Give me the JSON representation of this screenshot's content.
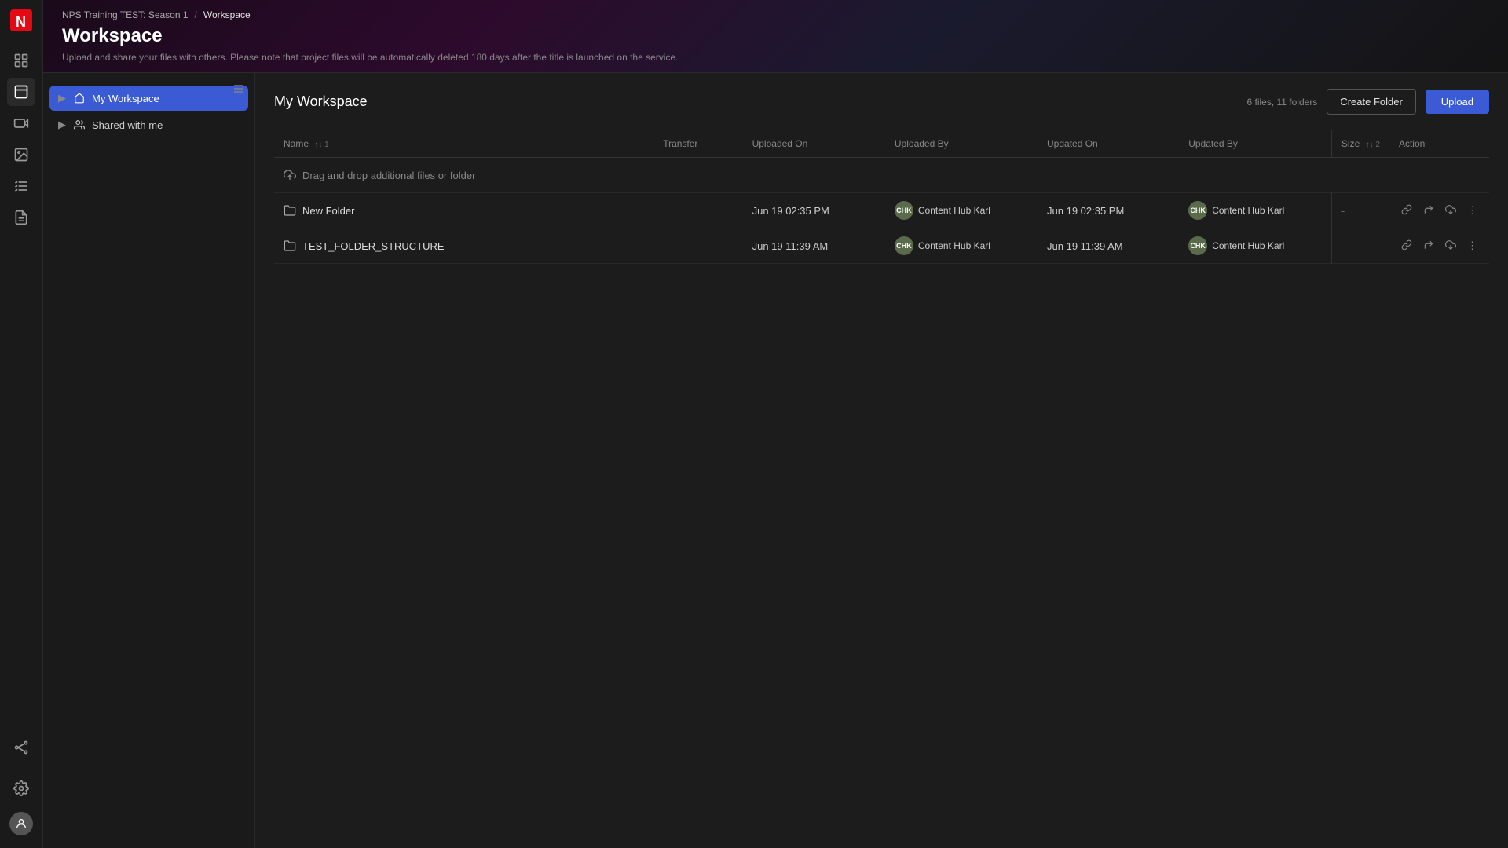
{
  "app": {
    "title": "NPS Training TEST: Season 1",
    "separator": "/",
    "breadcrumb_current": "Workspace",
    "page_title": "Workspace",
    "page_subtitle": "Upload and share your files with others. Please note that project files will be automatically deleted 180 days after the title is launched on the service."
  },
  "sidebar": {
    "toggle_label": "⇄",
    "items": [
      {
        "id": "my-workspace",
        "label": "My Workspace",
        "icon": "workspace",
        "active": true
      },
      {
        "id": "shared-with-me",
        "label": "Shared with me",
        "icon": "shared",
        "active": false
      }
    ]
  },
  "workspace": {
    "title": "My Workspace",
    "file_count": "6 files, 11 folders",
    "create_folder_label": "Create Folder",
    "upload_label": "Upload"
  },
  "table": {
    "columns": [
      {
        "key": "name",
        "label": "Name",
        "sort": "↑↓ 1"
      },
      {
        "key": "transfer",
        "label": "Transfer"
      },
      {
        "key": "uploaded_on",
        "label": "Uploaded On"
      },
      {
        "key": "uploaded_by",
        "label": "Uploaded By"
      },
      {
        "key": "updated_on",
        "label": "Updated On"
      },
      {
        "key": "updated_by",
        "label": "Updated By"
      },
      {
        "key": "size",
        "label": "Size",
        "sort": "↑↓ 2"
      },
      {
        "key": "action",
        "label": "Action"
      }
    ],
    "drop_zone_text": "Drag and drop additional files or folder",
    "rows": [
      {
        "id": "row-1",
        "name": "New Folder",
        "type": "folder",
        "transfer": "",
        "uploaded_on": "Jun 19 02:35 PM",
        "uploaded_by": "Content Hub Karl",
        "uploaded_by_initials": "CHK",
        "updated_on": "Jun 19 02:35 PM",
        "updated_by": "Content Hub Karl",
        "updated_by_initials": "CHK",
        "size": "-"
      },
      {
        "id": "row-2",
        "name": "TEST_FOLDER_STRUCTURE",
        "type": "folder",
        "transfer": "",
        "uploaded_on": "Jun 19 11:39 AM",
        "uploaded_by": "Content Hub Karl",
        "uploaded_by_initials": "CHK",
        "updated_on": "Jun 19 11:39 AM",
        "updated_by": "Content Hub Karl",
        "updated_by_initials": "CHK",
        "size": "-"
      }
    ]
  },
  "nav_icons": {
    "home": "⊞",
    "workspace": "⬜",
    "projects": "🎬",
    "media": "🖼",
    "tasks": "📋",
    "reports": "📊",
    "pipeline": "⚙",
    "settings": "⚙"
  },
  "colors": {
    "active_nav": "#3a5bd4",
    "brand_red": "#e50914",
    "user_badge_bg": "#5a6a4a"
  }
}
